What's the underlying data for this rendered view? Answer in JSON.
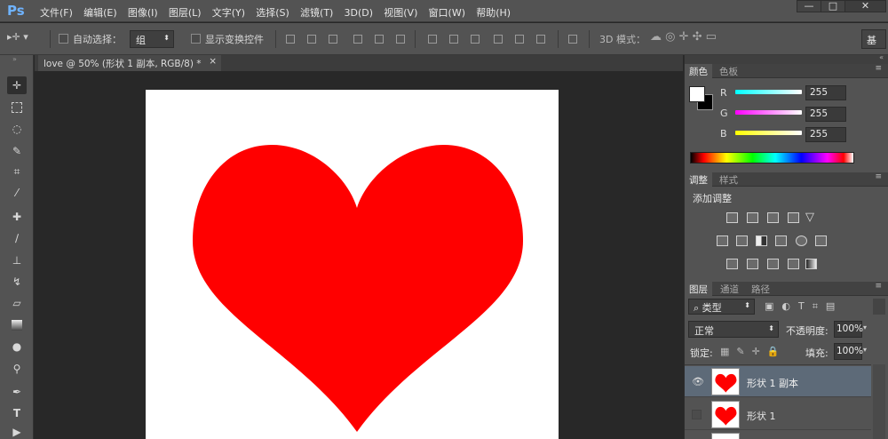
{
  "app": {
    "logo": "Ps"
  },
  "menu": [
    "文件(F)",
    "编辑(E)",
    "图像(I)",
    "图层(L)",
    "文字(Y)",
    "选择(S)",
    "滤镜(T)",
    "3D(D)",
    "视图(V)",
    "窗口(W)",
    "帮助(H)"
  ],
  "window_controls": {
    "minimize": "—",
    "maximize": "□",
    "close": "✕"
  },
  "options": {
    "auto_select_label": "自动选择：",
    "auto_select_value": "组",
    "show_transform_label": "显示变换控件",
    "mode3d_label": "3D 模式：",
    "workspace": "基"
  },
  "document": {
    "tab_title": "love @ 50% (形状 1 副本, RGB/8) *",
    "tab_close": "×",
    "shape_color": "#ff0000"
  },
  "color_panel": {
    "tabs": [
      "颜色",
      "色板"
    ],
    "channels": [
      {
        "name": "R",
        "value": "255"
      },
      {
        "name": "G",
        "value": "255"
      },
      {
        "name": "B",
        "value": "255"
      }
    ]
  },
  "adjust_panel": {
    "tabs": [
      "调整",
      "样式"
    ],
    "title": "添加调整"
  },
  "layers_panel": {
    "tabs": [
      "图层",
      "通道",
      "路径"
    ],
    "filter_label": "类型",
    "blend_mode": "正常",
    "opacity_label": "不透明度:",
    "opacity_value": "100%",
    "lock_label": "锁定:",
    "fill_label": "填充:",
    "fill_value": "100%",
    "layers": [
      {
        "name": "形状 1 副本"
      },
      {
        "name": "形状 1"
      }
    ]
  }
}
